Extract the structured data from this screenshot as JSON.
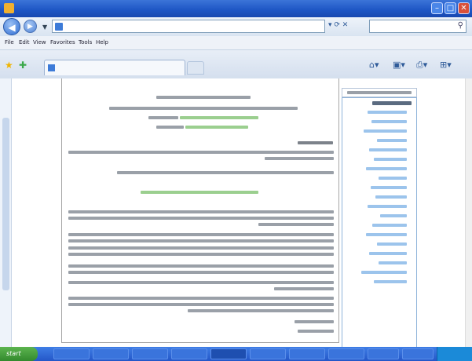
{
  "titlebar": {
    "title": ""
  },
  "address_bar": {
    "url": ""
  },
  "search": {
    "placeholder": ""
  },
  "menu": [
    "File",
    "Edit",
    "View",
    "Favorites",
    "Tools",
    "Help"
  ],
  "tab": {
    "title": ""
  },
  "taskbar": {
    "start_label": "start",
    "clock": ""
  },
  "colors": {
    "titlebar": "#1d55c4",
    "article_green_text": "#9bcf8f",
    "sidebar_link": "#9cc4ec",
    "taskbar": "#2457c8",
    "start_button": "#338a2e"
  }
}
